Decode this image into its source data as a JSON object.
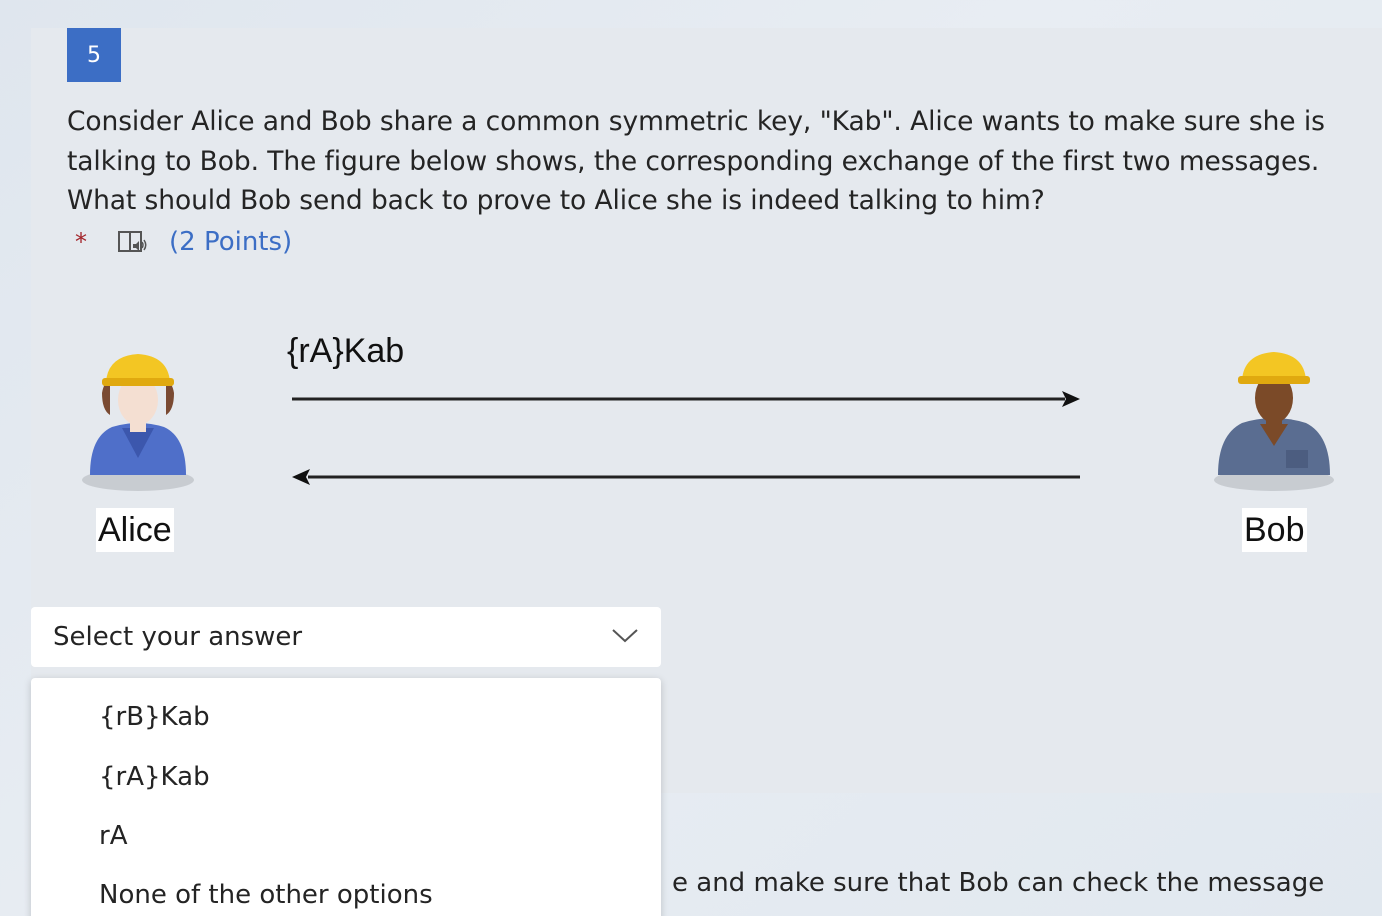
{
  "question": {
    "number": "5",
    "text": "Consider Alice and Bob share a common symmetric key, \"Kab\". Alice wants to make sure she is talking to Bob. The figure below shows, the corresponding exchange of the first two messages. What should Bob send back to prove to Alice she is indeed talking to him?",
    "required_marker": "*",
    "points": "(2 Points)",
    "reader_icon": "immersive-reader-icon"
  },
  "figure": {
    "message_label": "{rA}Kab",
    "left_person": "Alice",
    "right_person": "Bob"
  },
  "answer": {
    "placeholder": "Select your answer",
    "options": [
      "{rB}Kab",
      "{rA}Kab",
      "rA",
      "None of the other options"
    ]
  },
  "next_question_partial": {
    "line1": "e and make sure that Bob can check the message",
    "line2": "e and make sure that Bob can check the message"
  },
  "colors": {
    "accent": "#3c6ec5",
    "required": "#a4262c"
  }
}
